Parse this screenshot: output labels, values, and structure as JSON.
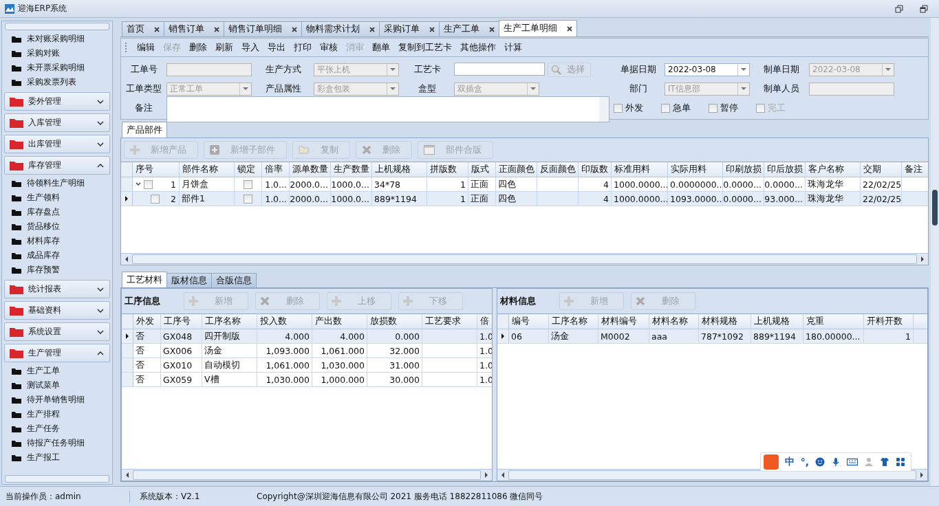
{
  "window": {
    "title": "迎海ERP系统"
  },
  "sidebar": {
    "top_items": [
      "未对账采购明细",
      "采购对账",
      "未开票采购明细",
      "采购发票列表"
    ],
    "groups": [
      {
        "label": "委外管理",
        "expanded": false
      },
      {
        "label": "入库管理",
        "expanded": false
      },
      {
        "label": "出库管理",
        "expanded": false
      },
      {
        "label": "库存管理",
        "expanded": true,
        "items": [
          "待领料生产明细",
          "生产领料",
          "库存盘点",
          "货品移位",
          "材料库存",
          "成品库存",
          "库存预警"
        ]
      },
      {
        "label": "统计报表",
        "expanded": false
      },
      {
        "label": "基础资料",
        "expanded": false
      },
      {
        "label": "系统设置",
        "expanded": false
      },
      {
        "label": "生产管理",
        "expanded": true,
        "items": [
          "生产工单",
          "测试菜单",
          "待开单销售明细",
          "生产排程",
          "生产任务",
          "待报产任务明细",
          "生产报工"
        ]
      }
    ]
  },
  "tabs": [
    {
      "label": "首页",
      "selected": false
    },
    {
      "label": "销售订单",
      "selected": false
    },
    {
      "label": "销售订单明细",
      "selected": false
    },
    {
      "label": "物料需求计划",
      "selected": false
    },
    {
      "label": "采购订单",
      "selected": false
    },
    {
      "label": "生产工单",
      "selected": false
    },
    {
      "label": "生产工单明细",
      "selected": true
    }
  ],
  "toolbar": [
    {
      "label": "编辑",
      "disabled": false
    },
    {
      "label": "保存",
      "disabled": true
    },
    {
      "label": "删除",
      "disabled": false
    },
    {
      "label": "刷新",
      "disabled": false
    },
    {
      "label": "导入",
      "disabled": false
    },
    {
      "label": "导出",
      "disabled": false
    },
    {
      "label": "打印",
      "disabled": false
    },
    {
      "label": "审核",
      "disabled": false
    },
    {
      "label": "消审",
      "disabled": true
    },
    {
      "label": "翻单",
      "disabled": false
    },
    {
      "label": "复制到工艺卡",
      "disabled": false
    },
    {
      "label": "其他操作",
      "disabled": false
    },
    {
      "label": "计算",
      "disabled": false
    }
  ],
  "form": {
    "fields": [
      {
        "label": "工单号",
        "kind": "text",
        "disabled": true
      },
      {
        "label": "生产方式",
        "kind": "combo",
        "value": "平张上机",
        "disabled": true
      },
      {
        "label": "工艺卡",
        "kind": "picker",
        "disabled": false,
        "button": "选择"
      },
      {
        "label": "单据日期",
        "kind": "combo",
        "value": "2022-03-08",
        "disabled": false
      },
      {
        "label": "制单日期",
        "kind": "combo",
        "value": "2022-03-08",
        "disabled": true
      },
      {
        "label": "工单类型",
        "kind": "combo",
        "value": "正常工单",
        "disabled": true
      },
      {
        "label": "产品属性",
        "kind": "combo",
        "value": "彩盒包装",
        "disabled": true
      },
      {
        "label": "盒型",
        "kind": "combo",
        "value": "双插盒",
        "disabled": true
      },
      {
        "label": "部门",
        "kind": "combo",
        "value": "IT信息部",
        "disabled": true
      },
      {
        "label": "制单人员",
        "kind": "text",
        "disabled": true
      }
    ],
    "memo": {
      "label": "备注"
    },
    "checkboxes": [
      {
        "label": "外发",
        "checked": false,
        "disabled": false
      },
      {
        "label": "急单",
        "checked": false,
        "disabled": false
      },
      {
        "label": "暂停",
        "checked": false,
        "disabled": false
      },
      {
        "label": "完工",
        "checked": false,
        "disabled": true
      }
    ]
  },
  "product_panel": {
    "tab": "产品部件",
    "buttons": [
      {
        "label": "新增产品",
        "kind": "add",
        "disabled": true
      },
      {
        "label": "新增子部件",
        "kind": "add-sub",
        "disabled": true
      },
      {
        "label": "复制",
        "kind": "copy",
        "disabled": true
      },
      {
        "label": "删除",
        "kind": "delete",
        "disabled": true
      },
      {
        "label": "部件合版",
        "kind": "merge",
        "disabled": true
      }
    ],
    "columns": [
      "序号",
      "部件名称",
      "锁定",
      "倍率",
      "源单数量",
      "生产数量",
      "上机规格",
      "拼版数",
      "版式",
      "正面颜色",
      "反面颜色",
      "印版数",
      "标准用料",
      "实际用料",
      "印刷放损",
      "印后放损",
      "客户名称",
      "交期",
      "备注"
    ],
    "rows": [
      {
        "checked": false,
        "expanded": true,
        "locked": false,
        "selected": false,
        "cells": [
          "1",
          "月饼盒",
          null,
          "1.0...",
          "2000.0...",
          "1000.0...",
          "34*78",
          "1",
          "正面",
          "四色",
          "",
          "4",
          "1000.0000...",
          "0.0000000...",
          "0.0000...",
          "0.0000...",
          "珠海龙华",
          "22/02/25",
          ""
        ],
        "children": [
          {
            "checked": false,
            "locked": false,
            "selected": true,
            "cells": [
              "2",
              "部件1",
              null,
              "1.0...",
              "2000.0...",
              "1000.0...",
              "889*1194",
              "1",
              "正面",
              "四色",
              "",
              "4",
              "1000.0000...",
              "1093.0000...",
              "0.0000...",
              "93.000...",
              "珠海龙华",
              "22/02/25",
              ""
            ]
          }
        ]
      }
    ]
  },
  "bottom_tabs": [
    {
      "label": "工艺材料",
      "selected": true
    },
    {
      "label": "版材信息",
      "selected": false
    },
    {
      "label": "合版信息",
      "selected": false
    }
  ],
  "process_panel": {
    "title": "工序信息",
    "buttons": [
      {
        "label": "新增",
        "kind": "add",
        "disabled": true
      },
      {
        "label": "删除",
        "kind": "delete",
        "disabled": true
      },
      {
        "label": "上移",
        "kind": "add",
        "disabled": true
      },
      {
        "label": "下移",
        "kind": "add",
        "disabled": true
      }
    ],
    "columns": [
      "外发",
      "工序号",
      "工序名称",
      "投入数",
      "产出数",
      "放损数",
      "工艺要求",
      "倍"
    ],
    "rows": [
      {
        "selected": true,
        "cells": [
          "否",
          "GX048",
          "四开制版",
          "4.000",
          "4.000",
          "0.000",
          "",
          "1.0"
        ]
      },
      {
        "selected": false,
        "cells": [
          "否",
          "GX006",
          "汤金",
          "1,093.000",
          "1,061.000",
          "32.000",
          "",
          "1.0"
        ]
      },
      {
        "selected": false,
        "cells": [
          "否",
          "GX010",
          "自动模切",
          "1,061.000",
          "1,030.000",
          "31.000",
          "",
          "1.0"
        ]
      },
      {
        "selected": false,
        "cells": [
          "否",
          "GX059",
          "V槽",
          "1,030.000",
          "1,000.000",
          "30.000",
          "",
          "1.0"
        ]
      }
    ]
  },
  "material_panel": {
    "title": "材料信息",
    "buttons": [
      {
        "label": "新增",
        "kind": "add",
        "disabled": true
      },
      {
        "label": "删除",
        "kind": "delete",
        "disabled": true
      }
    ],
    "columns": [
      "编号",
      "工序名称",
      "材料编号",
      "材料名称",
      "材料规格",
      "上机规格",
      "克重",
      "开料开数"
    ],
    "rows": [
      {
        "selected": true,
        "cells": [
          "06",
          "汤金",
          "M0002",
          "aaa",
          "787*1092",
          "889*1194",
          "180.00000...",
          "1"
        ]
      }
    ]
  },
  "ime_bar": {
    "mode": "中",
    "punctuation": "°,"
  },
  "status_bar": {
    "operator": "当前操作员：admin",
    "version": "系统版本：V2.1",
    "copyright": "Copyright@深圳迎海信息有限公司 2021    服务电话 18822811086 微信同号"
  }
}
